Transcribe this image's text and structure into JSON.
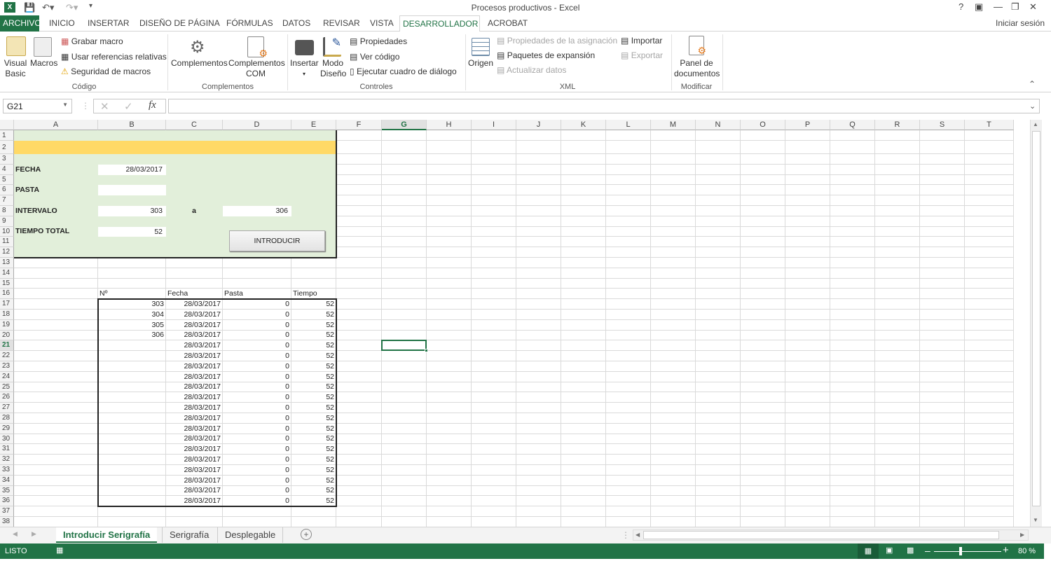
{
  "window": {
    "title": "Procesos productivos - Excel",
    "help": "?",
    "signin": "Iniciar sesión"
  },
  "ribbon_tabs": [
    "ARCHIVO",
    "INICIO",
    "INSERTAR",
    "DISEÑO DE PÁGINA",
    "FÓRMULAS",
    "DATOS",
    "REVISAR",
    "VISTA",
    "DESARROLLADOR",
    "ACROBAT"
  ],
  "active_tab": "DESARROLLADOR",
  "ribbon": {
    "codigo": {
      "visual_basic_1": "Visual",
      "visual_basic_2": "Basic",
      "macros": "Macros",
      "grabar": "Grabar macro",
      "relativas": "Usar referencias relativas",
      "seguridad": "Seguridad de macros",
      "label": "Código"
    },
    "complementos": {
      "complementos": "Complementos",
      "com_1": "Complementos",
      "com_2": "COM",
      "label": "Complementos"
    },
    "controles": {
      "insertar": "Insertar",
      "modo_1": "Modo",
      "modo_2": "Diseño",
      "propiedades": "Propiedades",
      "ver_codigo": "Ver código",
      "ejecutar": "Ejecutar cuadro de diálogo",
      "label": "Controles"
    },
    "xml": {
      "origen": "Origen",
      "prop_asignacion": "Propiedades de la asignación",
      "paquetes": "Paquetes de expansión",
      "actualizar": "Actualizar datos",
      "importar": "Importar",
      "exportar": "Exportar",
      "label": "XML"
    },
    "modificar": {
      "panel_1": "Panel de",
      "panel_2": "documentos",
      "label": "Modificar"
    }
  },
  "formula_bar": {
    "name_box": "G21",
    "formula": ""
  },
  "columns": [
    "A",
    "B",
    "C",
    "D",
    "E",
    "F",
    "G",
    "H",
    "I",
    "J",
    "K",
    "L",
    "M",
    "N",
    "O",
    "P",
    "Q",
    "R",
    "S",
    "T"
  ],
  "selected_cell": "G21",
  "form": {
    "fecha_label": "FECHA",
    "fecha_value": "28/03/2017",
    "pasta_label": "PASTA",
    "pasta_value": "",
    "intervalo_label": "INTERVALO",
    "intervalo_from": "303",
    "a_label": "a",
    "intervalo_to": "306",
    "tiempo_label": "TIEMPO TOTAL",
    "tiempo_value": "52",
    "button": "INTRODUCIR"
  },
  "table": {
    "headers": [
      "Nº",
      "Fecha",
      "Pasta",
      "Tiempo"
    ],
    "rows": [
      [
        "303",
        "28/03/2017",
        "0",
        "52"
      ],
      [
        "304",
        "28/03/2017",
        "0",
        "52"
      ],
      [
        "305",
        "28/03/2017",
        "0",
        "52"
      ],
      [
        "306",
        "28/03/2017",
        "0",
        "52"
      ],
      [
        "",
        "28/03/2017",
        "0",
        "52"
      ],
      [
        "",
        "28/03/2017",
        "0",
        "52"
      ],
      [
        "",
        "28/03/2017",
        "0",
        "52"
      ],
      [
        "",
        "28/03/2017",
        "0",
        "52"
      ],
      [
        "",
        "28/03/2017",
        "0",
        "52"
      ],
      [
        "",
        "28/03/2017",
        "0",
        "52"
      ],
      [
        "",
        "28/03/2017",
        "0",
        "52"
      ],
      [
        "",
        "28/03/2017",
        "0",
        "52"
      ],
      [
        "",
        "28/03/2017",
        "0",
        "52"
      ],
      [
        "",
        "28/03/2017",
        "0",
        "52"
      ],
      [
        "",
        "28/03/2017",
        "0",
        "52"
      ],
      [
        "",
        "28/03/2017",
        "0",
        "52"
      ],
      [
        "",
        "28/03/2017",
        "0",
        "52"
      ],
      [
        "",
        "28/03/2017",
        "0",
        "52"
      ],
      [
        "",
        "28/03/2017",
        "0",
        "52"
      ],
      [
        "",
        "28/03/2017",
        "0",
        "52"
      ]
    ]
  },
  "sheet_tabs": [
    "Introducir Serigrafía",
    "Serigrafía",
    "Desplegable"
  ],
  "active_sheet": "Introducir Serigrafía",
  "status": {
    "mode": "LISTO",
    "zoom": "80 %",
    "zoom_percent": 80
  },
  "colors": {
    "accent": "#217346",
    "form_fill": "#e2efda",
    "header_fill": "#ffd966"
  }
}
